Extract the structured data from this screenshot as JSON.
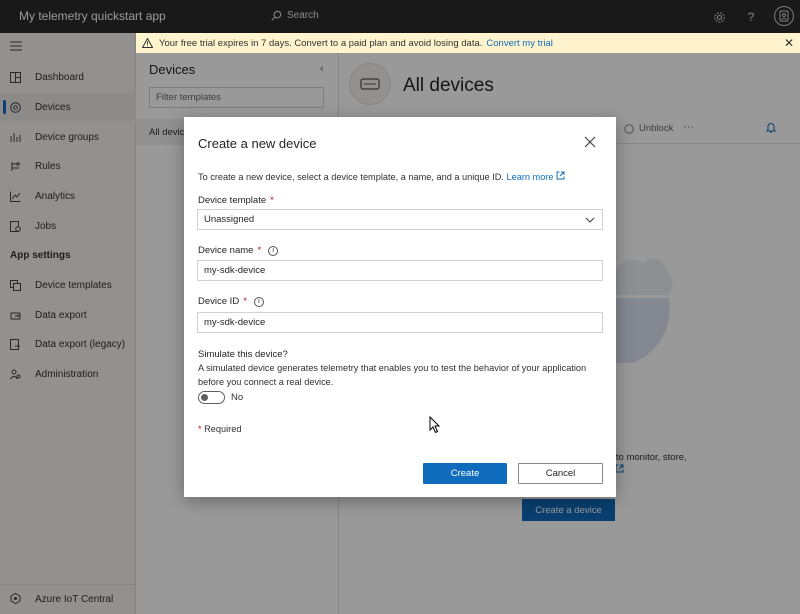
{
  "topbar": {
    "app_title": "My telemetry quickstart app",
    "search_label": "Search",
    "icons": [
      "gear-icon",
      "help-icon",
      "avatar-icon"
    ]
  },
  "banner": {
    "message": "Your free trial expires in 7 days. Convert to a paid plan and avoid losing data.",
    "link": "Convert my trial"
  },
  "sidebar": {
    "items": [
      {
        "label": "Dashboard",
        "icon": "dashboard-icon"
      },
      {
        "label": "Devices",
        "icon": "devices-icon",
        "active": true
      },
      {
        "label": "Device groups",
        "icon": "device-groups-icon"
      },
      {
        "label": "Rules",
        "icon": "rules-icon"
      },
      {
        "label": "Analytics",
        "icon": "analytics-icon"
      },
      {
        "label": "Jobs",
        "icon": "jobs-icon"
      }
    ],
    "section_label": "App settings",
    "settings_items": [
      {
        "label": "Device templates",
        "icon": "device-templates-icon"
      },
      {
        "label": "Data export",
        "icon": "data-export-icon"
      },
      {
        "label": "Data export (legacy)",
        "icon": "data-export-legacy-icon"
      },
      {
        "label": "Administration",
        "icon": "administration-icon"
      }
    ],
    "footer": "Azure IoT Central"
  },
  "devices_panel": {
    "title": "Devices",
    "filter_placeholder": "Filter templates",
    "all_devices": "All devic"
  },
  "main": {
    "title": "All devices",
    "unblock": "Unblock",
    "partial_text": "u to monitor, store,",
    "create_button": "Create a device"
  },
  "dialog": {
    "title": "Create a new device",
    "description": "To create a new device, select a device template, a name, and a unique ID.",
    "learn_more": "Learn more",
    "template_label": "Device template",
    "template_value": "Unassigned",
    "name_label": "Device name",
    "name_value": "my-sdk-device",
    "id_label": "Device ID",
    "id_value": "my-sdk-device",
    "simulate_title": "Simulate this device?",
    "simulate_desc": "A simulated device generates telemetry that enables you to test the behavior of your application before you connect a real device.",
    "toggle_label": "No",
    "required_marker": "*",
    "required_note": "Required",
    "create_label": "Create",
    "cancel_label": "Cancel"
  }
}
